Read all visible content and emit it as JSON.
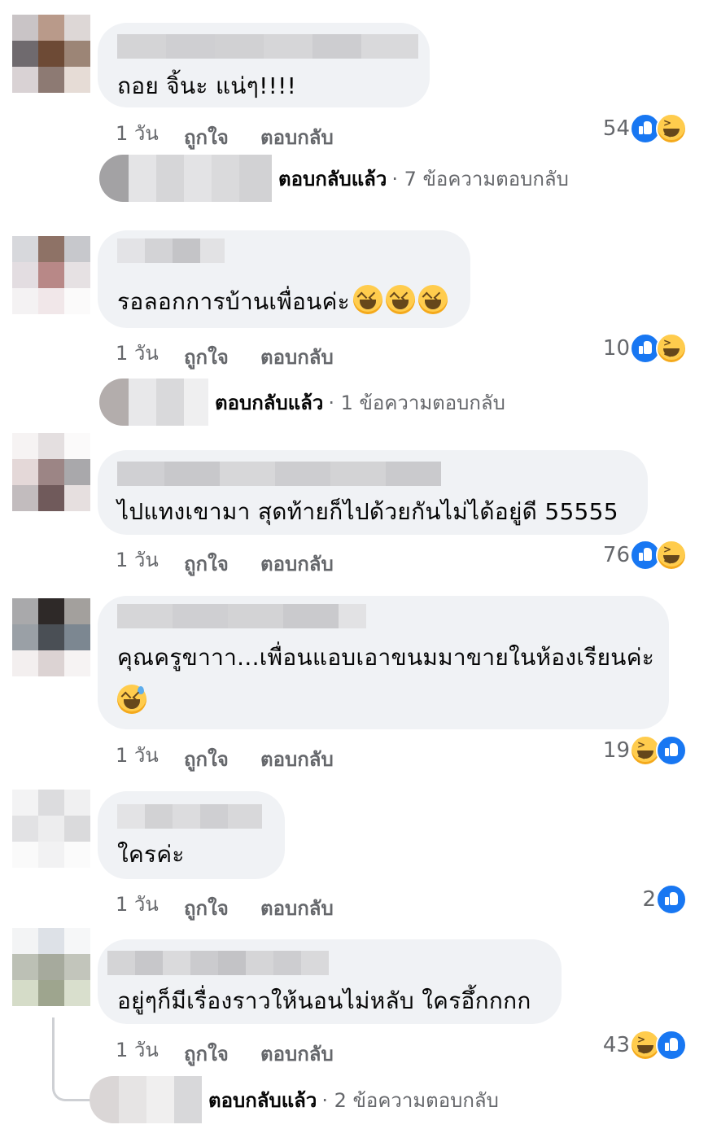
{
  "comments": [
    {
      "text": "ถอย จิ้นะ แน่ๆ!!!!",
      "time": "1 วัน",
      "like_label": "ถูกใจ",
      "reply_label": "ตอบกลับ",
      "reaction_count": "54",
      "reactions": [
        "like-icon",
        "haha-icon"
      ],
      "replies": {
        "label": "ตอบกลับแล้ว",
        "count_text": "· 7 ข้อความตอบกลับ"
      }
    },
    {
      "text": "รอลอกการบ้านเพื่อนค่ะ",
      "emojis": [
        "grinning-squinting-face-icon",
        "grinning-squinting-face-icon",
        "grinning-squinting-face-icon"
      ],
      "time": "1 วัน",
      "like_label": "ถูกใจ",
      "reply_label": "ตอบกลับ",
      "reaction_count": "10",
      "reactions": [
        "like-icon",
        "haha-icon"
      ],
      "replies": {
        "label": "ตอบกลับแล้ว",
        "count_text": "· 1 ข้อความตอบกลับ"
      }
    },
    {
      "text": "ไปแทงเขามา สุดท้ายก็ไปด้วยกันไม่ได้อยู่ดี 55555",
      "time": "1 วัน",
      "like_label": "ถูกใจ",
      "reply_label": "ตอบกลับ",
      "reaction_count": "76",
      "reactions": [
        "like-icon",
        "haha-icon"
      ]
    },
    {
      "text": "คุณครูขาาา...เพื่อนแอบเอาขนมมาขายในห้องเรียนค่ะ",
      "emojis": [
        "grinning-sweat-face-icon"
      ],
      "time": "1 วัน",
      "like_label": "ถูกใจ",
      "reply_label": "ตอบกลับ",
      "reaction_count": "19",
      "reactions": [
        "haha-icon",
        "like-icon"
      ]
    },
    {
      "text": "ใครค่ะ",
      "time": "1 วัน",
      "like_label": "ถูกใจ",
      "reply_label": "ตอบกลับ",
      "reaction_count": "2",
      "reactions": [
        "like-icon"
      ]
    },
    {
      "text": "อยู่ๆก็มีเรื่องราวให้นอนไม่หลับ ใครอึ้กกกก",
      "time": "1 วัน",
      "like_label": "ถูกใจ",
      "reply_label": "ตอบกลับ",
      "reaction_count": "43",
      "reactions": [
        "haha-icon",
        "like-icon"
      ],
      "replies": {
        "label": "ตอบกลับแล้ว",
        "count_text": "· 2 ข้อความตอบกลับ"
      }
    }
  ],
  "colors": {
    "bubble": "#f0f2f5",
    "meta_text": "#65676b",
    "like_blue": "#1877f2",
    "haha_yellow": "#ffcc4d"
  }
}
